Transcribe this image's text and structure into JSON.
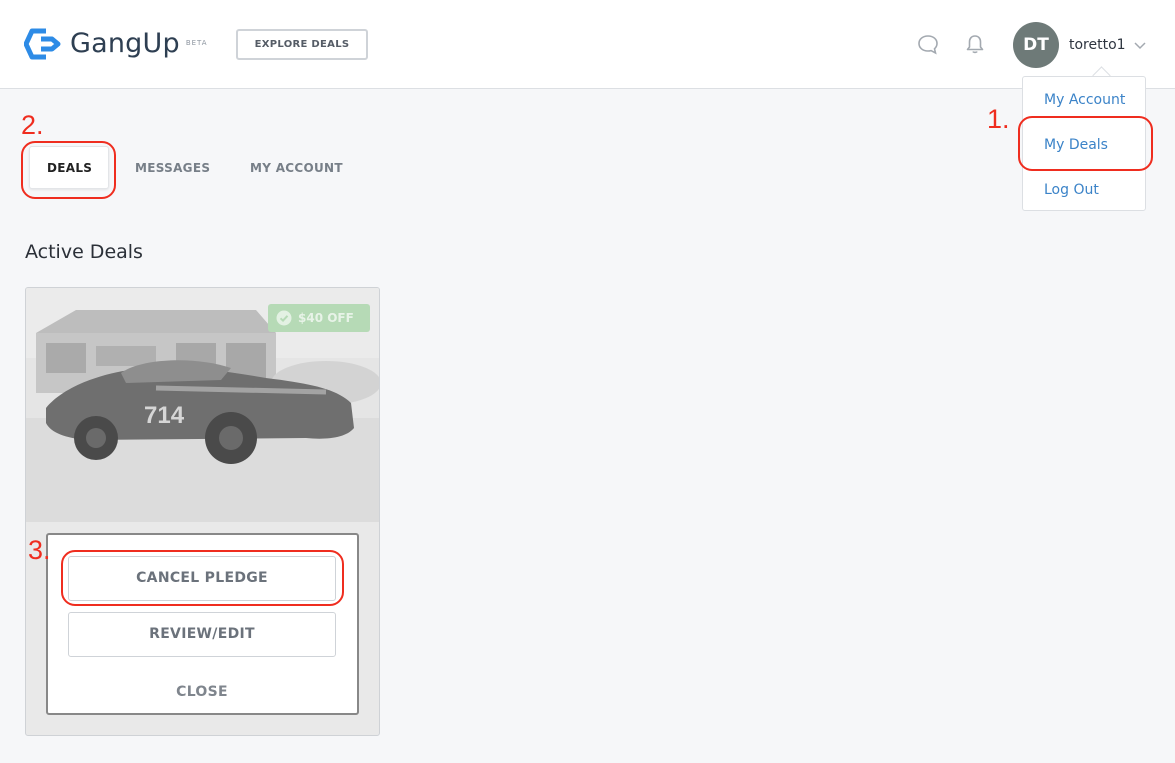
{
  "header": {
    "brand": "GangUp",
    "beta": "BETA",
    "explore_label": "EXPLORE DEALS",
    "avatar_initials": "DT",
    "username": "toretto1"
  },
  "dropdown": {
    "items": [
      {
        "label": "My Account"
      },
      {
        "label": "My Deals"
      },
      {
        "label": "Log Out"
      }
    ]
  },
  "tabs": [
    {
      "label": "DEALS",
      "active": true
    },
    {
      "label": "MESSAGES",
      "active": false
    },
    {
      "label": "MY ACCOUNT",
      "active": false
    }
  ],
  "section_title": "Active Deals",
  "card": {
    "badge_text": "$40 OFF",
    "modal": {
      "cancel_label": "CANCEL PLEDGE",
      "review_label": "REVIEW/EDIT",
      "close_label": "CLOSE"
    }
  },
  "annotations": [
    {
      "label": "1."
    },
    {
      "label": "2."
    },
    {
      "label": "3."
    }
  ],
  "colors": {
    "accent_blue": "#3b83c8",
    "annotation_red": "#ef2d1f",
    "logo_blue": "#2d8be6"
  }
}
